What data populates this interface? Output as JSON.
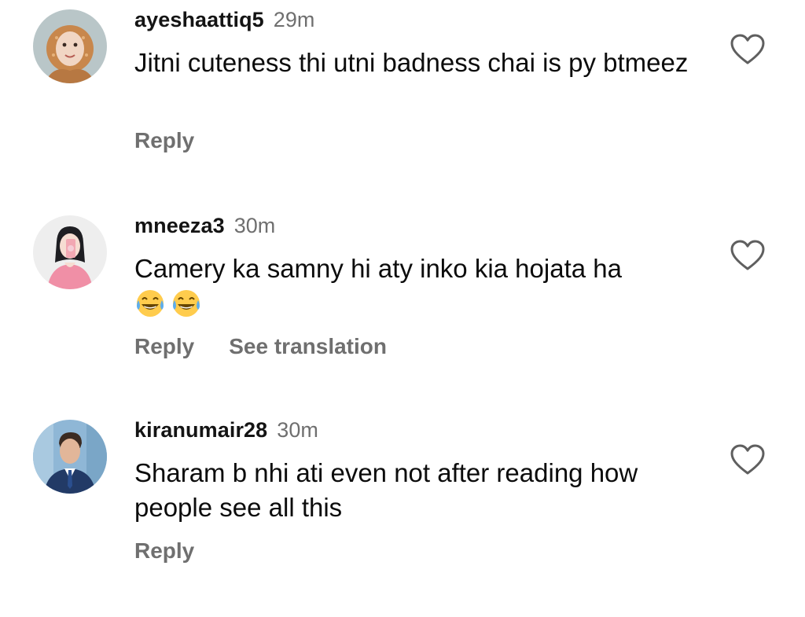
{
  "comments": [
    {
      "username": "ayeshaattiq5",
      "time": "29m",
      "text": "Jitni cuteness thi utni badness chai is py btmeez",
      "emojis": "",
      "actions": {
        "reply": "Reply",
        "translate": ""
      }
    },
    {
      "username": "mneeza3",
      "time": "30m",
      "text": "Camery ka samny hi aty inko kia hojata ha",
      "emojis": "😂😂",
      "actions": {
        "reply": "Reply",
        "translate": "See translation"
      }
    },
    {
      "username": "kiranumair28",
      "time": "30m",
      "text": "Sharam b nhi ati even not after reading how people see all this",
      "emojis": "",
      "actions": {
        "reply": "Reply",
        "translate": ""
      }
    }
  ],
  "icons": {
    "like": "heart-outline-icon",
    "emoji": "face-with-tears-of-joy"
  },
  "colors": {
    "username": "#141414",
    "secondary_text": "#6f6f6f",
    "body_text": "#0c0c0c"
  }
}
